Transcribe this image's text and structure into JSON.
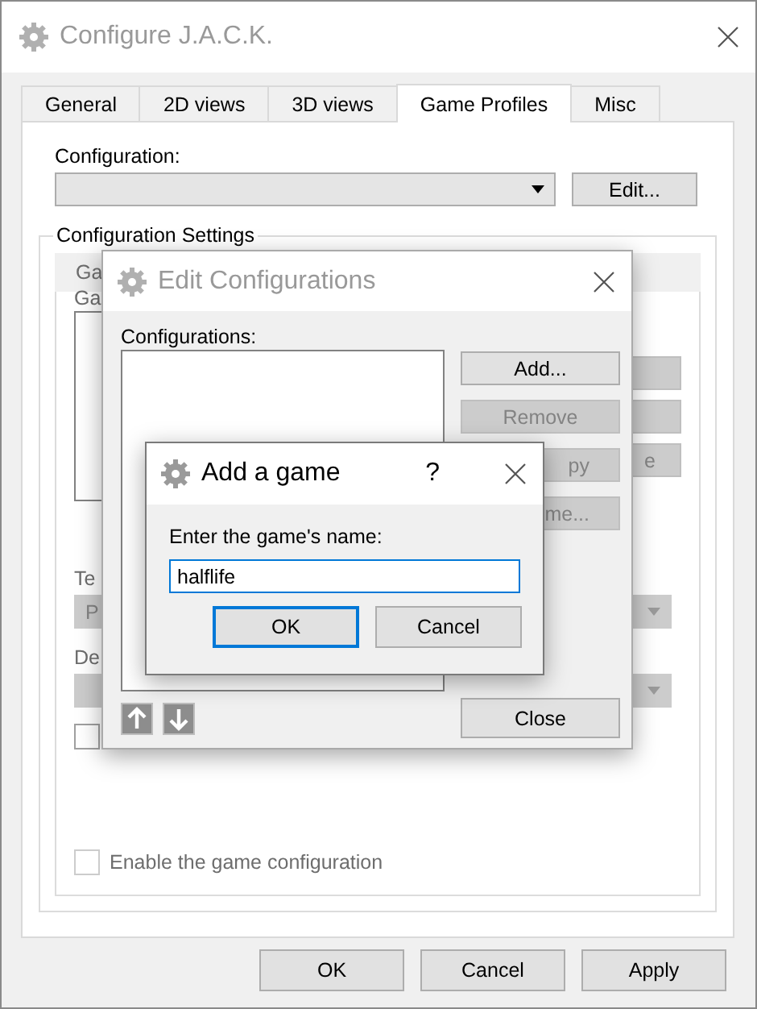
{
  "window": {
    "title": "Configure J.A.C.K."
  },
  "tabs": [
    {
      "label": "General",
      "selected": false
    },
    {
      "label": "2D views",
      "selected": false
    },
    {
      "label": "3D views",
      "selected": false
    },
    {
      "label": "Game Profiles",
      "selected": true
    },
    {
      "label": "Misc",
      "selected": false
    }
  ],
  "configuration": {
    "label": "Configuration:",
    "edit_button": "Edit..."
  },
  "settings": {
    "title": "Configuration Settings",
    "tabs": [
      {
        "label": "Ga",
        "selected": true
      }
    ],
    "list_label": "Ga",
    "side_buttons": [
      {
        "kind": "blank"
      },
      {
        "kind": "blank"
      },
      {
        "kind": "text",
        "label": "e"
      }
    ],
    "rows": [
      {
        "label": "Te",
        "value": "P"
      },
      {
        "label": "De"
      }
    ],
    "checkbox": {
      "checked": false
    },
    "enable": {
      "label": "Enable the game configuration",
      "checked": false,
      "disabled": true
    }
  },
  "edit_dialog": {
    "title": "Edit Configurations",
    "list_label": "Configurations:",
    "buttons": [
      {
        "label": "Add...",
        "disabled": false
      },
      {
        "label": "Remove",
        "disabled": true
      },
      {
        "label": "py",
        "disabled": true
      },
      {
        "label": "me...",
        "disabled": true
      }
    ],
    "close_button": "Close"
  },
  "add_dialog": {
    "title": "Add a game",
    "help": "?",
    "prompt": "Enter the game's name:",
    "value": "halflife",
    "buttons": [
      {
        "label": "OK",
        "default": true
      },
      {
        "label": "Cancel",
        "default": false
      }
    ]
  },
  "buttons": [
    "OK",
    "Cancel",
    "Apply"
  ]
}
